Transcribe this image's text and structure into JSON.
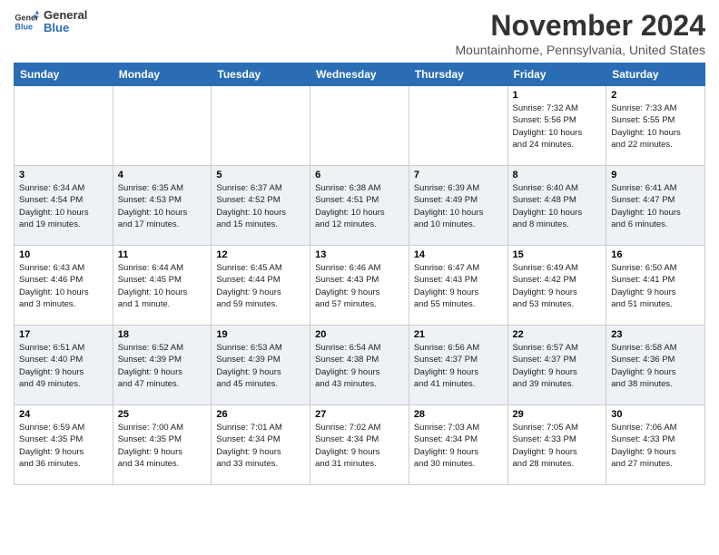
{
  "header": {
    "logo": {
      "general": "General",
      "blue": "Blue"
    },
    "title": "November 2024",
    "location": "Mountainhome, Pennsylvania, United States"
  },
  "weekdays": [
    "Sunday",
    "Monday",
    "Tuesday",
    "Wednesday",
    "Thursday",
    "Friday",
    "Saturday"
  ],
  "weeks": [
    [
      {
        "day": "",
        "info": ""
      },
      {
        "day": "",
        "info": ""
      },
      {
        "day": "",
        "info": ""
      },
      {
        "day": "",
        "info": ""
      },
      {
        "day": "",
        "info": ""
      },
      {
        "day": "1",
        "info": "Sunrise: 7:32 AM\nSunset: 5:56 PM\nDaylight: 10 hours\nand 24 minutes."
      },
      {
        "day": "2",
        "info": "Sunrise: 7:33 AM\nSunset: 5:55 PM\nDaylight: 10 hours\nand 22 minutes."
      }
    ],
    [
      {
        "day": "3",
        "info": "Sunrise: 6:34 AM\nSunset: 4:54 PM\nDaylight: 10 hours\nand 19 minutes."
      },
      {
        "day": "4",
        "info": "Sunrise: 6:35 AM\nSunset: 4:53 PM\nDaylight: 10 hours\nand 17 minutes."
      },
      {
        "day": "5",
        "info": "Sunrise: 6:37 AM\nSunset: 4:52 PM\nDaylight: 10 hours\nand 15 minutes."
      },
      {
        "day": "6",
        "info": "Sunrise: 6:38 AM\nSunset: 4:51 PM\nDaylight: 10 hours\nand 12 minutes."
      },
      {
        "day": "7",
        "info": "Sunrise: 6:39 AM\nSunset: 4:49 PM\nDaylight: 10 hours\nand 10 minutes."
      },
      {
        "day": "8",
        "info": "Sunrise: 6:40 AM\nSunset: 4:48 PM\nDaylight: 10 hours\nand 8 minutes."
      },
      {
        "day": "9",
        "info": "Sunrise: 6:41 AM\nSunset: 4:47 PM\nDaylight: 10 hours\nand 6 minutes."
      }
    ],
    [
      {
        "day": "10",
        "info": "Sunrise: 6:43 AM\nSunset: 4:46 PM\nDaylight: 10 hours\nand 3 minutes."
      },
      {
        "day": "11",
        "info": "Sunrise: 6:44 AM\nSunset: 4:45 PM\nDaylight: 10 hours\nand 1 minute."
      },
      {
        "day": "12",
        "info": "Sunrise: 6:45 AM\nSunset: 4:44 PM\nDaylight: 9 hours\nand 59 minutes."
      },
      {
        "day": "13",
        "info": "Sunrise: 6:46 AM\nSunset: 4:43 PM\nDaylight: 9 hours\nand 57 minutes."
      },
      {
        "day": "14",
        "info": "Sunrise: 6:47 AM\nSunset: 4:43 PM\nDaylight: 9 hours\nand 55 minutes."
      },
      {
        "day": "15",
        "info": "Sunrise: 6:49 AM\nSunset: 4:42 PM\nDaylight: 9 hours\nand 53 minutes."
      },
      {
        "day": "16",
        "info": "Sunrise: 6:50 AM\nSunset: 4:41 PM\nDaylight: 9 hours\nand 51 minutes."
      }
    ],
    [
      {
        "day": "17",
        "info": "Sunrise: 6:51 AM\nSunset: 4:40 PM\nDaylight: 9 hours\nand 49 minutes."
      },
      {
        "day": "18",
        "info": "Sunrise: 6:52 AM\nSunset: 4:39 PM\nDaylight: 9 hours\nand 47 minutes."
      },
      {
        "day": "19",
        "info": "Sunrise: 6:53 AM\nSunset: 4:39 PM\nDaylight: 9 hours\nand 45 minutes."
      },
      {
        "day": "20",
        "info": "Sunrise: 6:54 AM\nSunset: 4:38 PM\nDaylight: 9 hours\nand 43 minutes."
      },
      {
        "day": "21",
        "info": "Sunrise: 6:56 AM\nSunset: 4:37 PM\nDaylight: 9 hours\nand 41 minutes."
      },
      {
        "day": "22",
        "info": "Sunrise: 6:57 AM\nSunset: 4:37 PM\nDaylight: 9 hours\nand 39 minutes."
      },
      {
        "day": "23",
        "info": "Sunrise: 6:58 AM\nSunset: 4:36 PM\nDaylight: 9 hours\nand 38 minutes."
      }
    ],
    [
      {
        "day": "24",
        "info": "Sunrise: 6:59 AM\nSunset: 4:35 PM\nDaylight: 9 hours\nand 36 minutes."
      },
      {
        "day": "25",
        "info": "Sunrise: 7:00 AM\nSunset: 4:35 PM\nDaylight: 9 hours\nand 34 minutes."
      },
      {
        "day": "26",
        "info": "Sunrise: 7:01 AM\nSunset: 4:34 PM\nDaylight: 9 hours\nand 33 minutes."
      },
      {
        "day": "27",
        "info": "Sunrise: 7:02 AM\nSunset: 4:34 PM\nDaylight: 9 hours\nand 31 minutes."
      },
      {
        "day": "28",
        "info": "Sunrise: 7:03 AM\nSunset: 4:34 PM\nDaylight: 9 hours\nand 30 minutes."
      },
      {
        "day": "29",
        "info": "Sunrise: 7:05 AM\nSunset: 4:33 PM\nDaylight: 9 hours\nand 28 minutes."
      },
      {
        "day": "30",
        "info": "Sunrise: 7:06 AM\nSunset: 4:33 PM\nDaylight: 9 hours\nand 27 minutes."
      }
    ]
  ]
}
